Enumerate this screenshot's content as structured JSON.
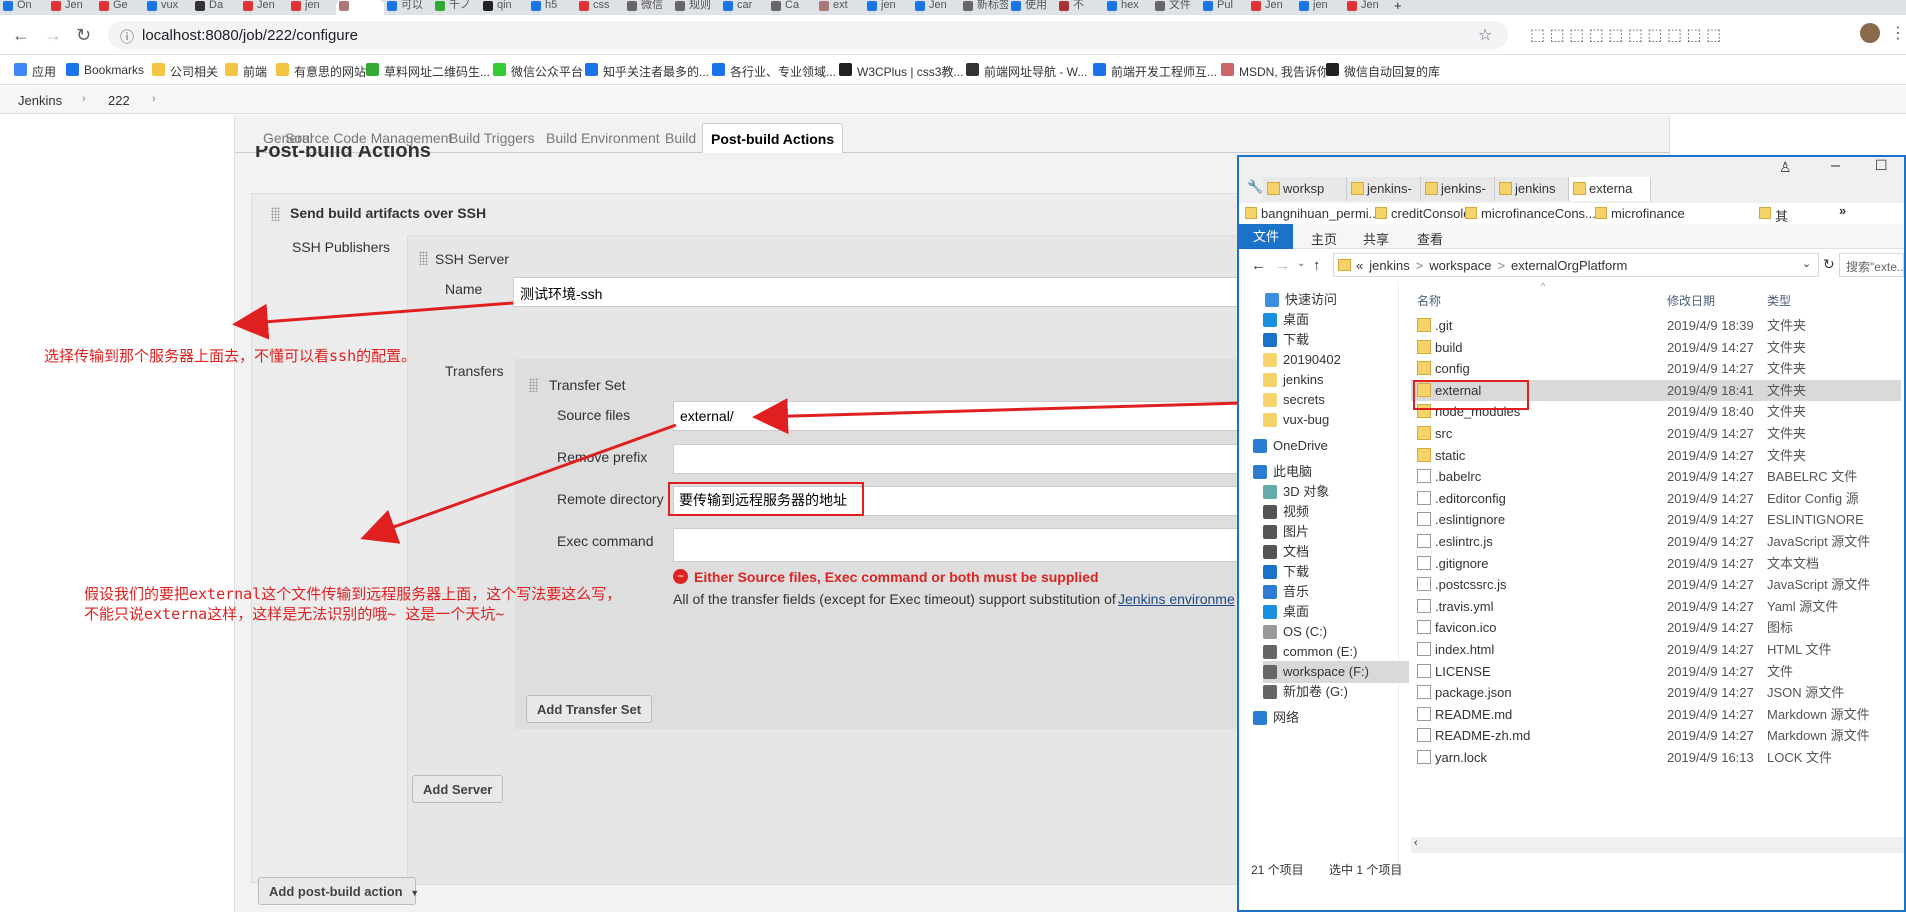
{
  "browser": {
    "tabs": [
      "On",
      "Jen",
      "Ge",
      "vux",
      "Da",
      "Jen",
      "jen",
      "",
      "可以",
      "千ノ",
      "qin",
      "h5",
      "css",
      "微信",
      "规则",
      "car",
      "Ca",
      "ext",
      "jen",
      "Jen",
      "新标签",
      "使用",
      "不",
      "hex",
      "文件",
      "Pul",
      "Jen",
      "jen",
      "Jen"
    ],
    "url": "localhost:8080/job/222/configure",
    "bookmarks": [
      "应用",
      "Bookmarks",
      "公司相关",
      "前端",
      "有意思的网站",
      "草料网址二维码生...",
      "微信公众平台",
      "知乎关注者最多的...",
      "各行业、专业领域...",
      "W3CPlus | css3教...",
      "前端网址导航 - W...",
      "前端开发工程师互...",
      "MSDN, 我告诉你",
      "微信自动回复的库"
    ]
  },
  "jenkins": {
    "breadcrumb": [
      "Jenkins",
      "222"
    ],
    "tabs": [
      "General",
      "Source Code Management",
      "Build Triggers",
      "Build Environment",
      "Build",
      "Post-build Actions"
    ],
    "section_title": "Post-build Actions",
    "plugin_title": "Send build artifacts over SSH",
    "ssh_publishers_label": "SSH Publishers",
    "ssh_server_label": "SSH Server",
    "name_label": "Name",
    "name_value": "测试环境-ssh",
    "transfers_label": "Transfers",
    "transfer_set_label": "Transfer Set",
    "source_files_label": "Source files",
    "source_files_value": "external/",
    "remove_prefix_label": "Remove prefix",
    "remote_directory_label": "Remote directory",
    "remote_directory_value": "要传输到远程服务器的地址",
    "exec_command_label": "Exec command",
    "error_text": "Either Source files, Exec command or both must be supplied",
    "help_text": "All of the transfer fields (except for Exec timeout) support substitution of",
    "help_link": "Jenkins environme",
    "add_transfer_set": "Add Transfer Set",
    "add_server": "Add Server",
    "add_post_build": "Add post-build action"
  },
  "annotations": {
    "note1": "选择传输到那个服务器上面去，不懂可以看ssh的配置。",
    "note2_line1": "假设我们的要把external这个文件传输到远程服务器上面，这个写法要这么写，",
    "note2_line2": "不能只说externa这样，这样是无法识别的哦~ 这是一个天坑~"
  },
  "explorer": {
    "tabs": [
      "worksp",
      "jenkins-",
      "jenkins-",
      "jenkins",
      "externa"
    ],
    "bookmarks": [
      "bangnihuan_permi...",
      "creditConsole",
      "microfinanceCons...",
      "microfinance",
      "其"
    ],
    "ribbon": [
      "文件",
      "主页",
      "共享",
      "查看"
    ],
    "path": [
      "«",
      "jenkins",
      ">",
      "workspace",
      ">",
      "externalOrgPlatform"
    ],
    "search_placeholder": "搜索\"exte...",
    "columns": [
      "名称",
      "修改日期",
      "类型"
    ],
    "nav": [
      {
        "label": "快速访问"
      },
      {
        "label": "桌面"
      },
      {
        "label": "下载"
      },
      {
        "label": "20190402"
      },
      {
        "label": "jenkins"
      },
      {
        "label": "secrets"
      },
      {
        "label": "vux-bug"
      },
      {
        "label": "OneDrive"
      },
      {
        "label": "此电脑"
      },
      {
        "label": "3D 对象"
      },
      {
        "label": "视频"
      },
      {
        "label": "图片"
      },
      {
        "label": "文档"
      },
      {
        "label": "下载"
      },
      {
        "label": "音乐"
      },
      {
        "label": "桌面"
      },
      {
        "label": "OS (C:)"
      },
      {
        "label": "common (E:)"
      },
      {
        "label": "workspace (F:)"
      },
      {
        "label": "新加卷 (G:)"
      },
      {
        "label": "网络"
      }
    ],
    "files": [
      {
        "name": ".git",
        "date": "2019/4/9 18:39",
        "type": "文件夹",
        "kind": "folder"
      },
      {
        "name": "build",
        "date": "2019/4/9 14:27",
        "type": "文件夹",
        "kind": "folder"
      },
      {
        "name": "config",
        "date": "2019/4/9 14:27",
        "type": "文件夹",
        "kind": "folder"
      },
      {
        "name": "external",
        "date": "2019/4/9 18:41",
        "type": "文件夹",
        "kind": "folder"
      },
      {
        "name": "node_modules",
        "date": "2019/4/9 18:40",
        "type": "文件夹",
        "kind": "folder"
      },
      {
        "name": "src",
        "date": "2019/4/9 14:27",
        "type": "文件夹",
        "kind": "folder"
      },
      {
        "name": "static",
        "date": "2019/4/9 14:27",
        "type": "文件夹",
        "kind": "folder"
      },
      {
        "name": ".babelrc",
        "date": "2019/4/9 14:27",
        "type": "BABELRC 文件",
        "kind": "file"
      },
      {
        "name": ".editorconfig",
        "date": "2019/4/9 14:27",
        "type": "Editor Config 源",
        "kind": "file"
      },
      {
        "name": ".eslintignore",
        "date": "2019/4/9 14:27",
        "type": "ESLINTIGNORE",
        "kind": "file"
      },
      {
        "name": ".eslintrc.js",
        "date": "2019/4/9 14:27",
        "type": "JavaScript 源文件",
        "kind": "file"
      },
      {
        "name": ".gitignore",
        "date": "2019/4/9 14:27",
        "type": "文本文档",
        "kind": "file"
      },
      {
        "name": ".postcssrc.js",
        "date": "2019/4/9 14:27",
        "type": "JavaScript 源文件",
        "kind": "file"
      },
      {
        "name": ".travis.yml",
        "date": "2019/4/9 14:27",
        "type": "Yaml 源文件",
        "kind": "file"
      },
      {
        "name": "favicon.ico",
        "date": "2019/4/9 14:27",
        "type": "图标",
        "kind": "file"
      },
      {
        "name": "index.html",
        "date": "2019/4/9 14:27",
        "type": "HTML 文件",
        "kind": "file"
      },
      {
        "name": "LICENSE",
        "date": "2019/4/9 14:27",
        "type": "文件",
        "kind": "file"
      },
      {
        "name": "package.json",
        "date": "2019/4/9 14:27",
        "type": "JSON 源文件",
        "kind": "file"
      },
      {
        "name": "README.md",
        "date": "2019/4/9 14:27",
        "type": "Markdown 源文件",
        "kind": "file"
      },
      {
        "name": "README-zh.md",
        "date": "2019/4/9 14:27",
        "type": "Markdown 源文件",
        "kind": "file"
      },
      {
        "name": "yarn.lock",
        "date": "2019/4/9 16:13",
        "type": "LOCK 文件",
        "kind": "file"
      }
    ],
    "status_count": "21 个项目",
    "status_selected": "选中 1 个项目"
  },
  "colors": {
    "accent": "#e02020",
    "explorer_blue": "#1a73c8",
    "folder": "#f4d36a"
  }
}
